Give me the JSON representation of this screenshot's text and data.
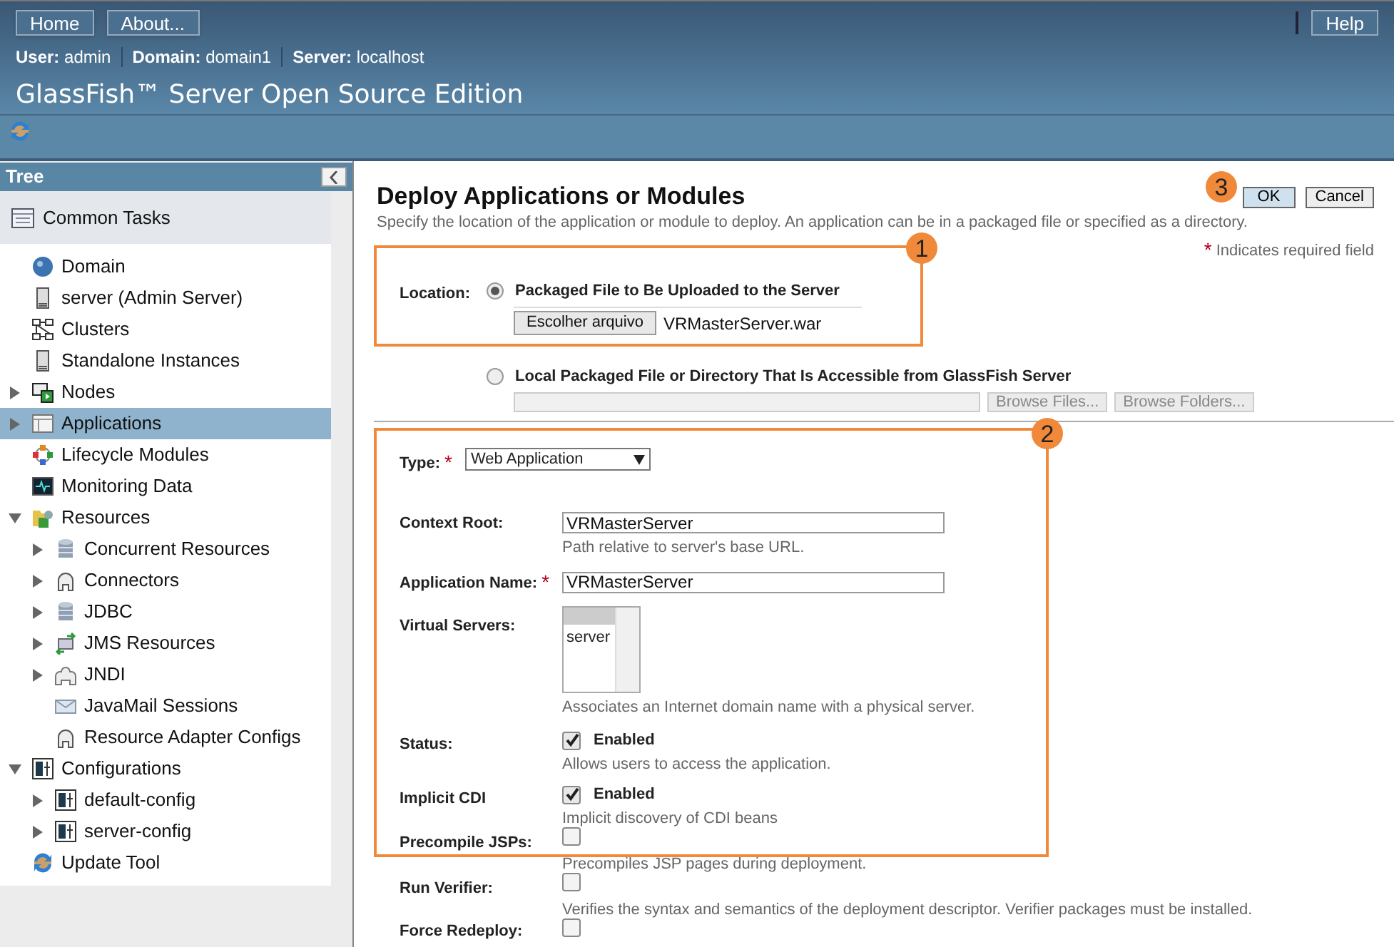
{
  "header": {
    "buttons": [
      {
        "label": "Home"
      },
      {
        "label": "About..."
      }
    ],
    "help_button": "Help",
    "info": [
      {
        "label": "User:",
        "value": "admin"
      },
      {
        "label": "Domain:",
        "value": "domain1"
      },
      {
        "label": "Server:",
        "value": "localhost"
      }
    ],
    "product_title": "GlassFish™ Server Open Source Edition"
  },
  "tree": {
    "title": "Tree",
    "common_tasks": "Common Tasks",
    "items": [
      {
        "label": "Domain",
        "kind": "globe",
        "selected": false
      },
      {
        "label": "server (Admin Server)",
        "kind": "server",
        "selected": false
      },
      {
        "label": "Clusters",
        "kind": "clusters",
        "selected": false
      },
      {
        "label": "Standalone Instances",
        "kind": "server",
        "selected": false
      },
      {
        "label": "Nodes",
        "kind": "nodes",
        "selected": false,
        "expanded": false
      },
      {
        "label": "Applications",
        "kind": "applications",
        "selected": true,
        "expanded": false
      },
      {
        "label": "Lifecycle Modules",
        "kind": "lifecycle",
        "selected": false
      },
      {
        "label": "Monitoring Data",
        "kind": "monitor",
        "selected": false
      },
      {
        "label": "Resources",
        "kind": "resources",
        "selected": false,
        "expanded": true,
        "children": [
          {
            "label": "Concurrent Resources",
            "kind": "database",
            "selected": false,
            "expanded": false
          },
          {
            "label": "Connectors",
            "kind": "connector",
            "selected": false,
            "expanded": false
          },
          {
            "label": "JDBC",
            "kind": "database",
            "selected": false,
            "expanded": false
          },
          {
            "label": "JMS Resources",
            "kind": "jms",
            "selected": false,
            "expanded": false
          },
          {
            "label": "JNDI",
            "kind": "jndi",
            "selected": false,
            "expanded": false
          },
          {
            "label": "JavaMail Sessions",
            "kind": "mail",
            "selected": false
          },
          {
            "label": "Resource Adapter Configs",
            "kind": "connector",
            "selected": false
          }
        ]
      },
      {
        "label": "Configurations",
        "kind": "config",
        "selected": false,
        "expanded": true,
        "children": [
          {
            "label": "default-config",
            "kind": "config",
            "selected": false,
            "expanded": false
          },
          {
            "label": "server-config",
            "kind": "config",
            "selected": false,
            "expanded": false
          }
        ]
      },
      {
        "label": "Update Tool",
        "kind": "update",
        "selected": false
      }
    ]
  },
  "page": {
    "title": "Deploy Applications or Modules",
    "description": "Specify the location of the application or module to deploy. An application can be in a packaged file or specified as a directory.",
    "buttons": [
      {
        "label": "OK",
        "kind": "primary"
      },
      {
        "label": "Cancel",
        "kind": "secondary"
      }
    ],
    "required_mark": "*",
    "required_note": "Indicates required field",
    "location": {
      "label": "Location:",
      "options": [
        {
          "kind": "upload",
          "label": "Packaged File to Be Uploaded to the Server",
          "selected": true,
          "button": "Escolher arquivo",
          "file": "VRMasterServer.war"
        },
        {
          "kind": "local",
          "label": "Local Packaged File or Directory That Is Accessible from GlassFish Server",
          "selected": false,
          "buttons": [
            "Browse Files...",
            "Browse Folders..."
          ]
        }
      ]
    },
    "fields": [
      {
        "kind": "select",
        "label": "Type:",
        "required": true,
        "value": "Web Application"
      },
      {
        "kind": "text",
        "label": "Context Root:",
        "required": false,
        "value": "VRMasterServer",
        "hint": "Path relative to server's base URL."
      },
      {
        "kind": "text",
        "label": "Application Name:",
        "required": true,
        "value": "VRMasterServer"
      },
      {
        "kind": "list",
        "label": "Virtual Servers:",
        "required": false,
        "options": [
          "server"
        ],
        "hint": "Associates an Internet domain name with a physical server."
      },
      {
        "kind": "checkbox",
        "label": "Status:",
        "checked": true,
        "option": "Enabled",
        "hint": "Allows users to access the application."
      },
      {
        "kind": "checkbox",
        "label": "Implicit CDI",
        "checked": true,
        "option": "Enabled",
        "hint": "Implicit discovery of CDI beans"
      },
      {
        "kind": "checkbox",
        "label": "Precompile JSPs:",
        "checked": false,
        "hint": "Precompiles JSP pages during deployment."
      },
      {
        "kind": "checkbox",
        "label": "Run Verifier:",
        "checked": false,
        "hint": "Verifies the syntax and semantics of the deployment descriptor. Verifier packages must be installed."
      },
      {
        "kind": "checkbox",
        "label": "Force Redeploy:",
        "checked": false
      }
    ]
  },
  "callouts": [
    "1",
    "2",
    "3"
  ]
}
